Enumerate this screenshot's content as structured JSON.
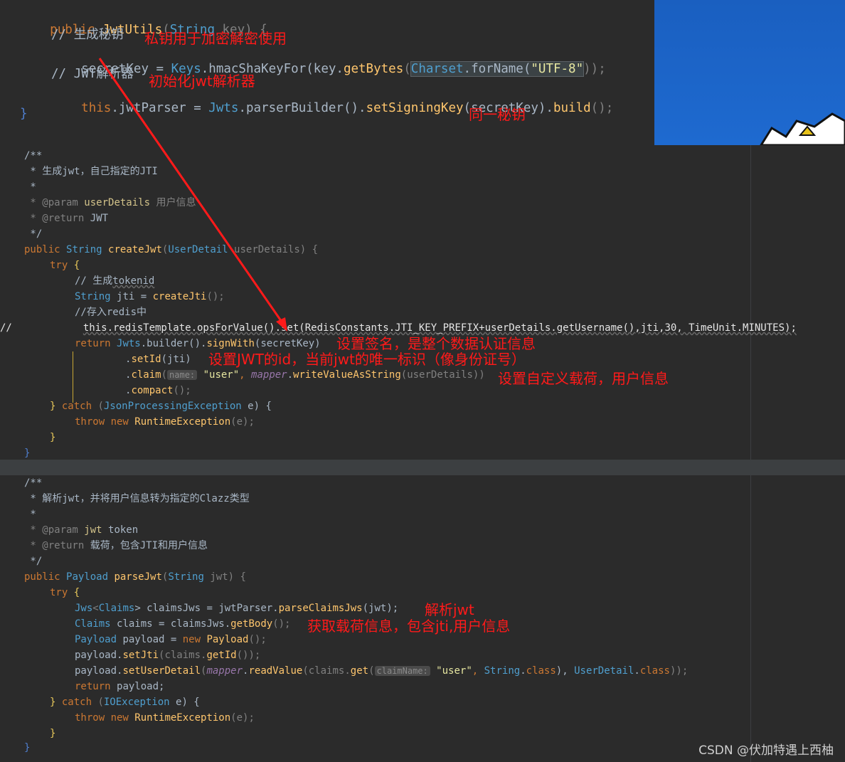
{
  "top_code": {
    "l1": {
      "kw": "public ",
      "fn": "JwtUtils",
      "p1": "(",
      "type": "String",
      " p": " key) ",
      "brace": "{"
    },
    "l2": "// 生成秘钥",
    "l3": {
      "a": "secretKey = ",
      "b": "Keys",
      "c": ".hmacShaKeyFor(key.",
      "d": "getBytes",
      "e": "(",
      "f": "Charset",
      "g": ".forName(",
      "h": "\"UTF-8\"",
      "i": "));"
    },
    "l4": "// JWT解析器",
    "l5": {
      "a": "this",
      "b": ".jwtParser = ",
      "c": "Jwts",
      "d": ".parserBuilder().",
      "e": "setSigningKey",
      "f": "(secretKey).",
      "g": "build",
      "h": "();"
    },
    "l6": "}"
  },
  "mid_code": {
    "l1": "/**",
    "l2": " * 生成jwt，自己指定的JTI",
    "l3": " *",
    "l4a": " * @param ",
    "l4b": "userDetails",
    "l4c": " 用户信息",
    "l5a": " * @return ",
    "l5b": "JWT",
    "l6": " */",
    "l7a": "public ",
    "l7b": "String ",
    "l7c": "createJwt",
    "l7d": "(",
    "l7e": "UserDetail",
    "l7f": " userDetails) {",
    "l8a": "try ",
    "l8b": "{",
    "l9a": "// 生成",
    "l9b": "tokenid",
    "l10a": "String ",
    "l10b": "jti = ",
    "l10c": "createJti",
    "l10d": "();",
    "l11": "//存入redis中",
    "l12a": "//",
    "l12b": "this.redisTemplate.opsForValue().set(RedisConstants.JTI_KEY_PREFIX+userDetails.getUsername(),jti,30, TimeUnit.MINUTES);",
    "l13a": "return ",
    "l13b": "Jwts",
    "l13c": ".builder().",
    "l13d": "signWith",
    "l13e": "(secretKey)",
    "l14a": ".",
    "l14b": "setId",
    "l14c": "(jti)",
    "l15a": ".",
    "l15b": "claim",
    "l15c": "(",
    "l15hint": "name:",
    "l15d": " \"user\"",
    "l15e": ", ",
    "l15f": "mapper",
    "l15g": ".",
    "l15h": "writeValueAsString",
    "l15i": "(userDetails))",
    "l16a": ".",
    "l16b": "compact",
    "l16c": "();",
    "l17a": "} ",
    "l17b": "catch ",
    "l17c": "(",
    "l17d": "JsonProcessingException",
    "l17e": " e) {",
    "l18a": "throw new ",
    "l18b": "RuntimeException",
    "l18c": "(e);",
    "l19": "}",
    "l20": "}"
  },
  "bot_code": {
    "l1": "/**",
    "l2": " * 解析jwt，并将用户信息转为指定的Clazz类型",
    "l3": " *",
    "l4a": " * @param ",
    "l4b": "jwt",
    "l4c": " token",
    "l5a": " * @return ",
    "l5b": "载荷，包含JTI和用户信息",
    "l6": " */",
    "l7a": "public ",
    "l7b": "Payload ",
    "l7c": "parseJwt",
    "l7d": "(",
    "l7e": "String",
    "l7f": " jwt) {",
    "l8a": "try ",
    "l8b": "{",
    "l9a": "Jws",
    "l9b": "<",
    "l9c": "Claims",
    "l9d": "> claimsJws = jwtParser.",
    "l9e": "parseClaimsJws",
    "l9f": "(jwt);",
    "l10a": "Claims ",
    "l10b": "claims = claimsJws.",
    "l10c": "getBody",
    "l10d": "();",
    "l11a": "Payload ",
    "l11b": "payload = ",
    "l11c": "new ",
    "l11d": "Payload",
    "l11e": "();",
    "l12a": "payload.",
    "l12b": "setJti",
    "l12c": "(claims.",
    "l12d": "getId",
    "l12e": "());",
    "l13a": "payload.",
    "l13b": "setUserDetail",
    "l13c": "(",
    "l13d": "mapper",
    "l13e": ".",
    "l13f": "readValue",
    "l13g": "(claims.",
    "l13h": "get",
    "l13i": "(",
    "l13hint": "claimName:",
    "l13j": " \"user\"",
    "l13k": ", ",
    "l13l": "String",
    "l13m": ".",
    "l13n": "class",
    "l13o": "), ",
    "l13p": "UserDetail",
    "l13q": ".",
    "l13r": "class",
    "l13s": "));",
    "l14a": "return ",
    "l14b": "payload;",
    "l15a": "} ",
    "l15b": "catch ",
    "l15c": "(",
    "l15d": "IOException",
    "l15e": " e) {",
    "l16a": "throw new ",
    "l16b": "RuntimeException",
    "l16c": "(e);",
    "l17": "}",
    "l18": "}"
  },
  "annotations": {
    "a1": "私钥用于加密解密使用",
    "a2": "初始化jwt解析器",
    "a3": "同一秘钥",
    "a4": "设置签名，是整个数据认证信息",
    "a5": "设置JWT的id，当前jwt的唯一标识（像身份证号）",
    "a6": "设置自定义载荷，用户信息",
    "a7": "解析jwt",
    "a8": "获取载荷信息，包含jti,用户信息"
  },
  "watermark": "CSDN @伏加特遇上西柚",
  "colors": {
    "keyword": "#cc7832",
    "function": "#ffc66d",
    "string": "#6a8759",
    "annotation": "#ff1a1a",
    "arrow": "#ff1a1a",
    "background": "#2b2b2b"
  }
}
